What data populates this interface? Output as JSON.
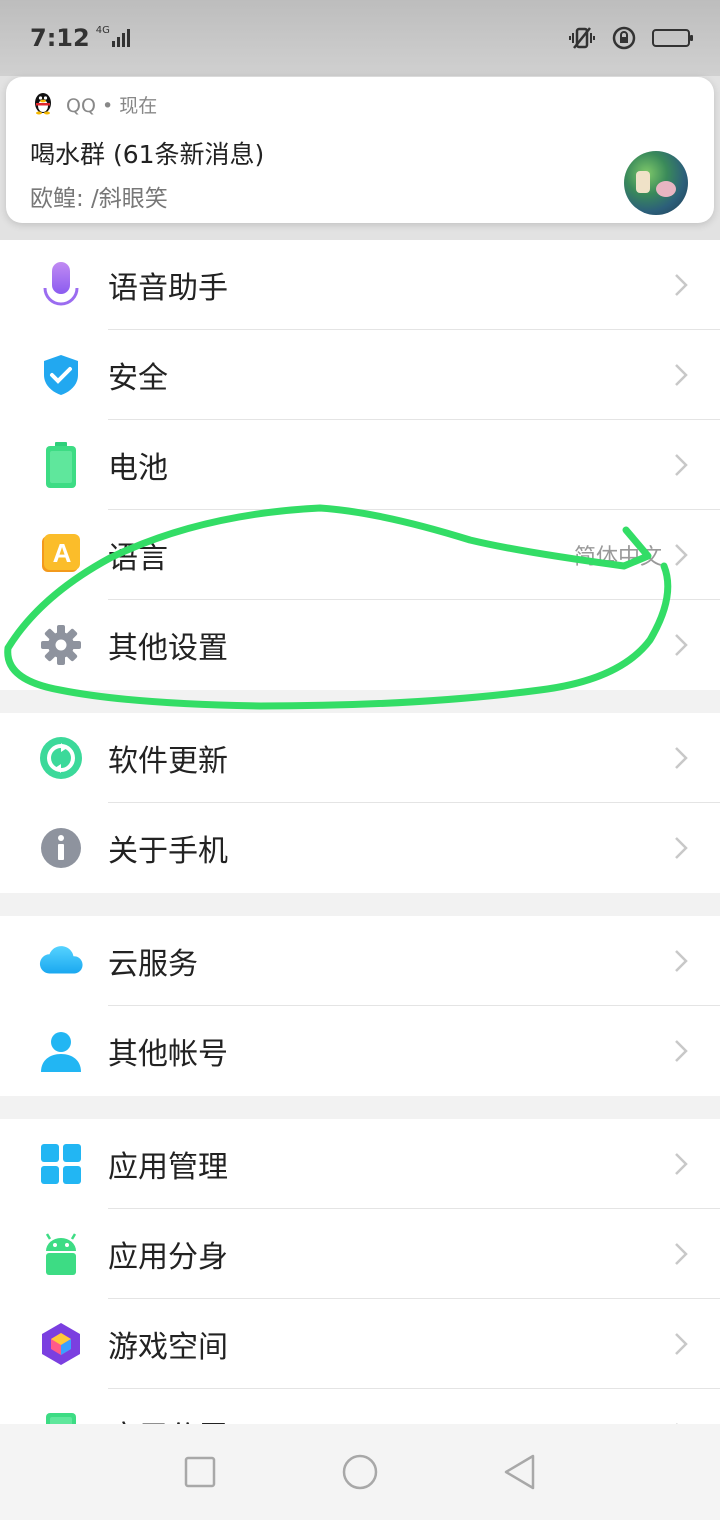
{
  "status_bar": {
    "time": "7:12",
    "network": "4G",
    "icons": [
      "vibrate-icon",
      "rotation-lock-icon",
      "battery-icon"
    ]
  },
  "notification": {
    "app": "QQ • 现在",
    "title": "喝水群 (61条新消息)",
    "body": "欧鳇: /斜眼笑",
    "icon": "qq-penguin-icon"
  },
  "groups": [
    {
      "items": [
        {
          "label": "语音助手",
          "icon": "microphone-icon",
          "value": ""
        },
        {
          "label": "安全",
          "icon": "shield-check-icon",
          "value": ""
        },
        {
          "label": "电池",
          "icon": "battery-green-icon",
          "value": ""
        },
        {
          "label": "语言",
          "icon": "language-a-icon",
          "value": "简体中文"
        },
        {
          "label": "其他设置",
          "icon": "gear-icon",
          "value": ""
        }
      ]
    },
    {
      "items": [
        {
          "label": "软件更新",
          "icon": "update-icon",
          "value": ""
        },
        {
          "label": "关于手机",
          "icon": "info-icon",
          "value": ""
        }
      ]
    },
    {
      "items": [
        {
          "label": "云服务",
          "icon": "cloud-icon",
          "value": ""
        },
        {
          "label": "其他帐号",
          "icon": "person-icon",
          "value": ""
        }
      ]
    },
    {
      "items": [
        {
          "label": "应用管理",
          "icon": "app-grid-icon",
          "value": ""
        },
        {
          "label": "应用分身",
          "icon": "android-clone-icon",
          "value": ""
        },
        {
          "label": "游戏空间",
          "icon": "game-cube-icon",
          "value": ""
        },
        {
          "label": "应用分屏",
          "icon": "split-screen-icon",
          "value": ""
        }
      ]
    }
  ],
  "nav": {
    "buttons": [
      "recents-square-icon",
      "home-circle-icon",
      "back-triangle-icon"
    ]
  },
  "colors": {
    "annotation": "#33dd66",
    "accent_green": "#3cd99a",
    "blue": "#22b6f3"
  }
}
